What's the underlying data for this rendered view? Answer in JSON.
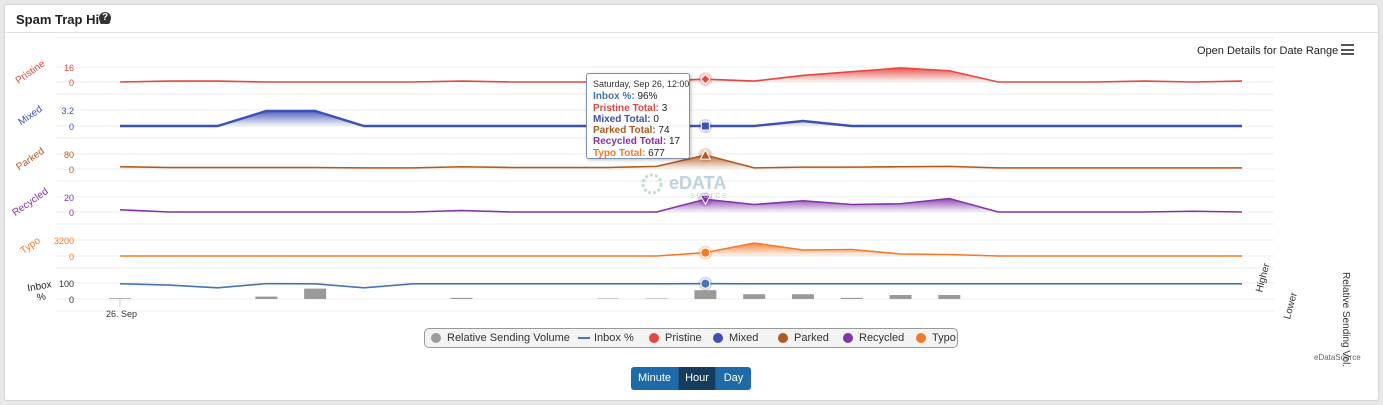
{
  "widget": {
    "title": "Spam Trap Hits",
    "help_icon": "question-circle-icon"
  },
  "menu": {
    "open_details_label": "Open Details for Date Range",
    "menu_icon": "hamburger-icon"
  },
  "tooltip": {
    "header": "Saturday, Sep 26, 12:00",
    "rows": [
      {
        "label": "Inbox %:",
        "value": "96%",
        "color": "#4572a7"
      },
      {
        "label": "Pristine Total:",
        "value": "3",
        "color": "#e4473f"
      },
      {
        "label": "Mixed Total:",
        "value": "0",
        "color": "#3f50b5"
      },
      {
        "label": "Parked Total:",
        "value": "74",
        "color": "#ae5b21"
      },
      {
        "label": "Recycled Total:",
        "value": "17",
        "color": "#8233a8"
      },
      {
        "label": "Typo Total:",
        "value": "677",
        "color": "#f5792a"
      }
    ]
  },
  "watermark": {
    "name": "eDATA",
    "sub": "source"
  },
  "legend": [
    {
      "name": "Relative Sending Volume",
      "color": "#9a9a9a",
      "symbol": "circle"
    },
    {
      "name": "Inbox %",
      "color": "#4a73b0",
      "symbol": "line"
    },
    {
      "name": "Pristine",
      "color": "#e4473f",
      "symbol": "circle"
    },
    {
      "name": "Mixed",
      "color": "#3f50b5",
      "symbol": "circle"
    },
    {
      "name": "Parked",
      "color": "#ae5b21",
      "symbol": "circle"
    },
    {
      "name": "Recycled",
      "color": "#8233a8",
      "symbol": "circle"
    },
    {
      "name": "Typo",
      "color": "#f5792a",
      "symbol": "circle"
    }
  ],
  "credit": "eDataSource",
  "buttons": [
    {
      "label": "Minute",
      "active": false
    },
    {
      "label": "Hour",
      "active": true
    },
    {
      "label": "Day",
      "active": false
    }
  ],
  "chart_data": {
    "type": "line",
    "x_tick_label": "26. Sep",
    "right_axis": {
      "title": "Relative Sending Vol.",
      "top_label": "Higher",
      "bottom_label": "Lower"
    },
    "highlight_index": 12,
    "panels": [
      {
        "name": "Pristine",
        "axis_title": "Pristine",
        "color": "#e4473f",
        "ticks": [
          "16",
          "0"
        ],
        "ylim": [
          0,
          16
        ],
        "values": [
          0,
          1,
          1,
          0,
          0,
          0,
          0,
          1,
          0,
          0,
          0,
          1,
          3,
          1,
          7,
          11,
          15,
          12,
          0,
          0,
          0,
          1,
          0,
          1
        ],
        "marker": "diamond"
      },
      {
        "name": "Mixed",
        "axis_title": "Mixed",
        "color": "#3f50b5",
        "ticks": [
          "3.2",
          "0"
        ],
        "ylim": [
          0,
          3.2
        ],
        "values": [
          0,
          0,
          0,
          3,
          3,
          0,
          0,
          0,
          0,
          0,
          0,
          0,
          0,
          0,
          1,
          0,
          0,
          0,
          0,
          0,
          0,
          0,
          0,
          0
        ],
        "marker": "square"
      },
      {
        "name": "Parked",
        "axis_title": "Parked",
        "color": "#ae5b21",
        "ticks": [
          "80",
          "0"
        ],
        "ylim": [
          0,
          80
        ],
        "values": [
          12,
          8,
          8,
          8,
          8,
          6,
          6,
          12,
          8,
          8,
          8,
          14,
          74,
          6,
          10,
          10,
          12,
          14,
          6,
          6,
          6,
          6,
          6,
          6
        ],
        "marker": "triangle"
      },
      {
        "name": "Recycled",
        "axis_title": "Recycled",
        "color": "#8233a8",
        "ticks": [
          "20",
          "0"
        ],
        "ylim": [
          0,
          20
        ],
        "values": [
          3,
          0,
          0,
          0,
          0,
          0,
          0,
          2,
          0,
          0,
          0,
          0,
          17,
          10,
          15,
          10,
          11,
          18,
          0,
          0,
          0,
          0,
          1,
          0
        ],
        "marker": "triangle-down"
      },
      {
        "name": "Typo",
        "axis_title": "Typo",
        "color": "#f5792a",
        "ticks": [
          "3200",
          "0"
        ],
        "ylim": [
          0,
          3200
        ],
        "values": [
          0,
          0,
          0,
          0,
          0,
          0,
          0,
          0,
          0,
          0,
          0,
          0,
          677,
          2600,
          1200,
          1300,
          400,
          300,
          0,
          0,
          0,
          0,
          0,
          0
        ],
        "marker": "circle"
      },
      {
        "name": "Inbox %",
        "axis_title": "Inbox %",
        "color": "#4a73b0",
        "ticks": [
          "100",
          "0"
        ],
        "ylim": [
          0,
          100
        ],
        "values": [
          95,
          87,
          70,
          96,
          95,
          70,
          95,
          95,
          95,
          95,
          95,
          95,
          96,
          95,
          95,
          95,
          95,
          95,
          95,
          95,
          95,
          95,
          95,
          95
        ],
        "marker": "circle"
      }
    ],
    "relative_sending_volume": {
      "color": "#9a9a9a",
      "values": [
        0.05,
        0,
        0,
        0.15,
        0.65,
        0,
        0,
        0.07,
        0,
        0,
        0.03,
        0.03,
        0.55,
        0.3,
        0.3,
        0.07,
        0.25,
        0.25,
        0,
        0,
        0,
        0,
        0,
        0
      ]
    }
  }
}
